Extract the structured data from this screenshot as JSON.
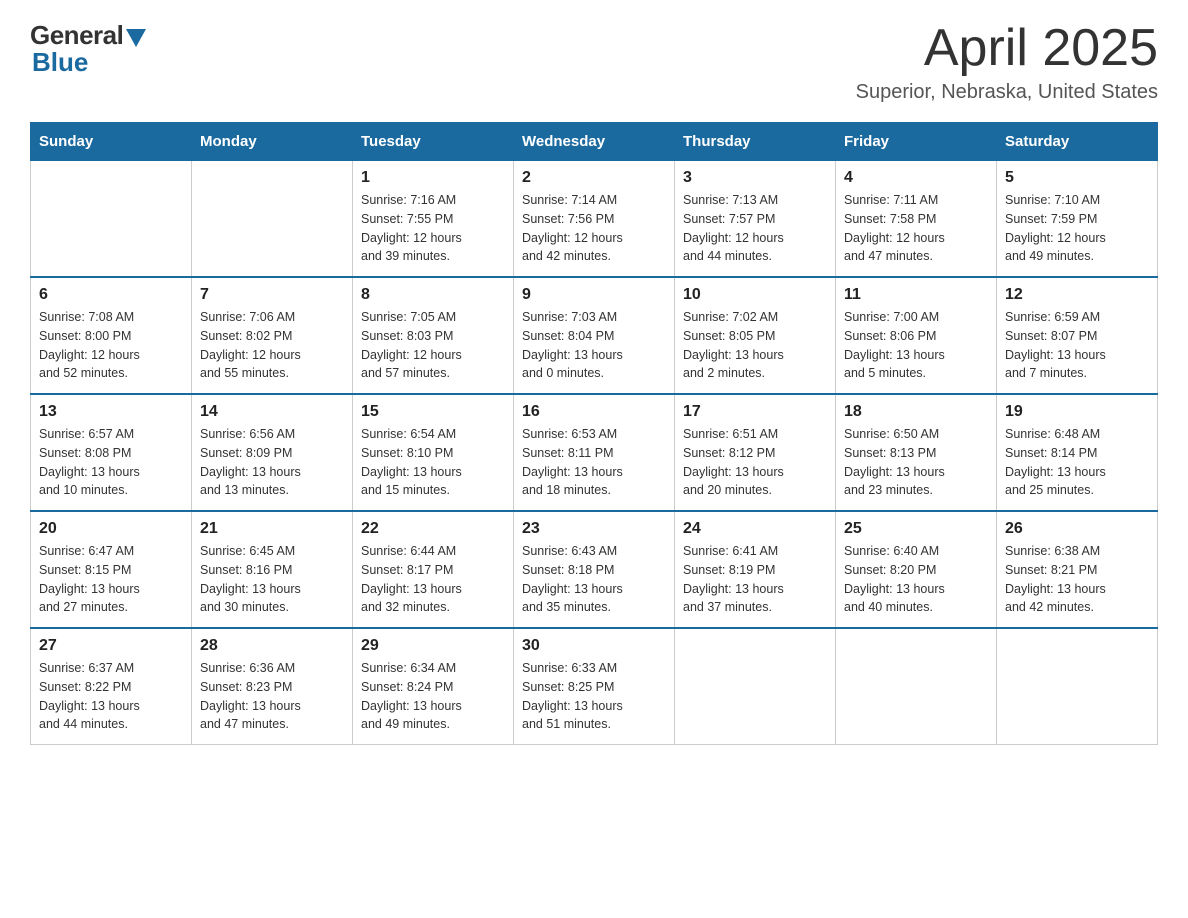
{
  "logo": {
    "general": "General",
    "blue": "Blue"
  },
  "title": "April 2025",
  "location": "Superior, Nebraska, United States",
  "days_header": [
    "Sunday",
    "Monday",
    "Tuesday",
    "Wednesday",
    "Thursday",
    "Friday",
    "Saturday"
  ],
  "weeks": [
    [
      {
        "day": "",
        "info": ""
      },
      {
        "day": "",
        "info": ""
      },
      {
        "day": "1",
        "info": "Sunrise: 7:16 AM\nSunset: 7:55 PM\nDaylight: 12 hours\nand 39 minutes."
      },
      {
        "day": "2",
        "info": "Sunrise: 7:14 AM\nSunset: 7:56 PM\nDaylight: 12 hours\nand 42 minutes."
      },
      {
        "day": "3",
        "info": "Sunrise: 7:13 AM\nSunset: 7:57 PM\nDaylight: 12 hours\nand 44 minutes."
      },
      {
        "day": "4",
        "info": "Sunrise: 7:11 AM\nSunset: 7:58 PM\nDaylight: 12 hours\nand 47 minutes."
      },
      {
        "day": "5",
        "info": "Sunrise: 7:10 AM\nSunset: 7:59 PM\nDaylight: 12 hours\nand 49 minutes."
      }
    ],
    [
      {
        "day": "6",
        "info": "Sunrise: 7:08 AM\nSunset: 8:00 PM\nDaylight: 12 hours\nand 52 minutes."
      },
      {
        "day": "7",
        "info": "Sunrise: 7:06 AM\nSunset: 8:02 PM\nDaylight: 12 hours\nand 55 minutes."
      },
      {
        "day": "8",
        "info": "Sunrise: 7:05 AM\nSunset: 8:03 PM\nDaylight: 12 hours\nand 57 minutes."
      },
      {
        "day": "9",
        "info": "Sunrise: 7:03 AM\nSunset: 8:04 PM\nDaylight: 13 hours\nand 0 minutes."
      },
      {
        "day": "10",
        "info": "Sunrise: 7:02 AM\nSunset: 8:05 PM\nDaylight: 13 hours\nand 2 minutes."
      },
      {
        "day": "11",
        "info": "Sunrise: 7:00 AM\nSunset: 8:06 PM\nDaylight: 13 hours\nand 5 minutes."
      },
      {
        "day": "12",
        "info": "Sunrise: 6:59 AM\nSunset: 8:07 PM\nDaylight: 13 hours\nand 7 minutes."
      }
    ],
    [
      {
        "day": "13",
        "info": "Sunrise: 6:57 AM\nSunset: 8:08 PM\nDaylight: 13 hours\nand 10 minutes."
      },
      {
        "day": "14",
        "info": "Sunrise: 6:56 AM\nSunset: 8:09 PM\nDaylight: 13 hours\nand 13 minutes."
      },
      {
        "day": "15",
        "info": "Sunrise: 6:54 AM\nSunset: 8:10 PM\nDaylight: 13 hours\nand 15 minutes."
      },
      {
        "day": "16",
        "info": "Sunrise: 6:53 AM\nSunset: 8:11 PM\nDaylight: 13 hours\nand 18 minutes."
      },
      {
        "day": "17",
        "info": "Sunrise: 6:51 AM\nSunset: 8:12 PM\nDaylight: 13 hours\nand 20 minutes."
      },
      {
        "day": "18",
        "info": "Sunrise: 6:50 AM\nSunset: 8:13 PM\nDaylight: 13 hours\nand 23 minutes."
      },
      {
        "day": "19",
        "info": "Sunrise: 6:48 AM\nSunset: 8:14 PM\nDaylight: 13 hours\nand 25 minutes."
      }
    ],
    [
      {
        "day": "20",
        "info": "Sunrise: 6:47 AM\nSunset: 8:15 PM\nDaylight: 13 hours\nand 27 minutes."
      },
      {
        "day": "21",
        "info": "Sunrise: 6:45 AM\nSunset: 8:16 PM\nDaylight: 13 hours\nand 30 minutes."
      },
      {
        "day": "22",
        "info": "Sunrise: 6:44 AM\nSunset: 8:17 PM\nDaylight: 13 hours\nand 32 minutes."
      },
      {
        "day": "23",
        "info": "Sunrise: 6:43 AM\nSunset: 8:18 PM\nDaylight: 13 hours\nand 35 minutes."
      },
      {
        "day": "24",
        "info": "Sunrise: 6:41 AM\nSunset: 8:19 PM\nDaylight: 13 hours\nand 37 minutes."
      },
      {
        "day": "25",
        "info": "Sunrise: 6:40 AM\nSunset: 8:20 PM\nDaylight: 13 hours\nand 40 minutes."
      },
      {
        "day": "26",
        "info": "Sunrise: 6:38 AM\nSunset: 8:21 PM\nDaylight: 13 hours\nand 42 minutes."
      }
    ],
    [
      {
        "day": "27",
        "info": "Sunrise: 6:37 AM\nSunset: 8:22 PM\nDaylight: 13 hours\nand 44 minutes."
      },
      {
        "day": "28",
        "info": "Sunrise: 6:36 AM\nSunset: 8:23 PM\nDaylight: 13 hours\nand 47 minutes."
      },
      {
        "day": "29",
        "info": "Sunrise: 6:34 AM\nSunset: 8:24 PM\nDaylight: 13 hours\nand 49 minutes."
      },
      {
        "day": "30",
        "info": "Sunrise: 6:33 AM\nSunset: 8:25 PM\nDaylight: 13 hours\nand 51 minutes."
      },
      {
        "day": "",
        "info": ""
      },
      {
        "day": "",
        "info": ""
      },
      {
        "day": "",
        "info": ""
      }
    ]
  ]
}
